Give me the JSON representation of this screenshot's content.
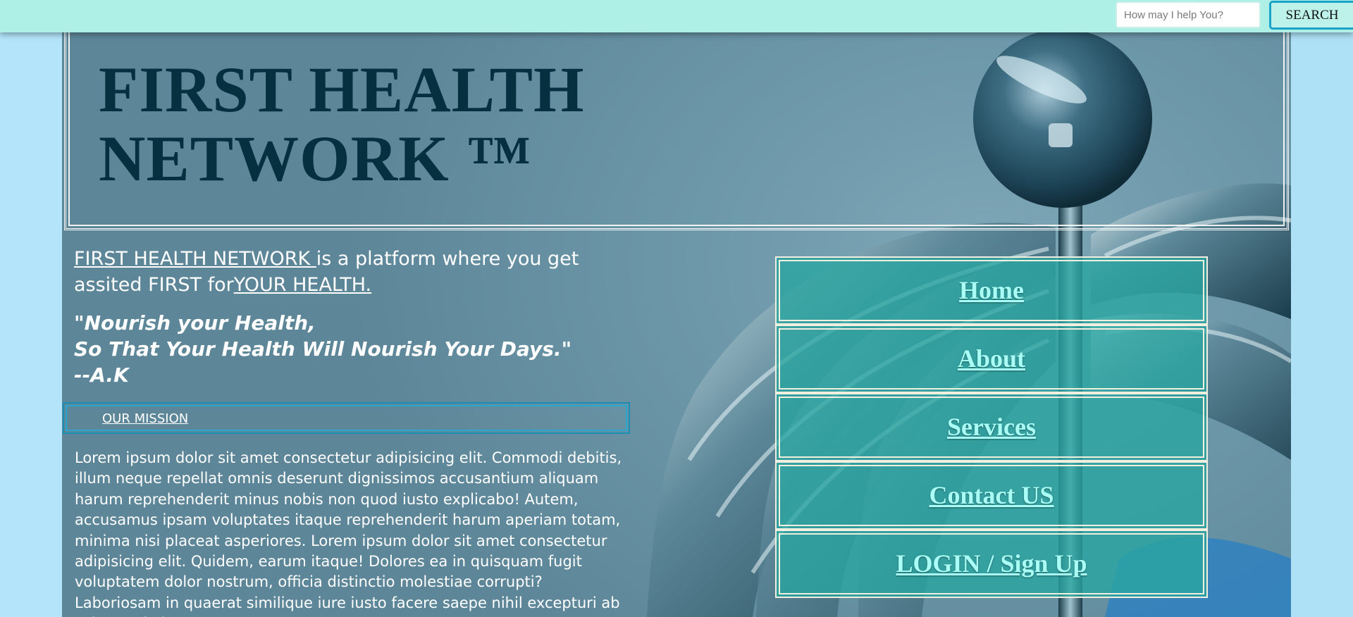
{
  "topbar": {
    "search_placeholder": "How may I help You?",
    "search_button_label": "SEARCH"
  },
  "header": {
    "title": "FIRST HEALTH\nNETWORK ™"
  },
  "intro": {
    "brand_link": "FIRST HEALTH NETWORK ",
    "text_part1": "is a platform where you get assited FIRST for",
    "health_link": "YOUR HEALTH."
  },
  "quote": {
    "line1": "\"Nourish your Health,",
    "line2": "So That Your Health Will Nourish Your Days.\"",
    "line3": "--A.K"
  },
  "mission": {
    "label": "OUR MISSION"
  },
  "body": {
    "lorem": "Lorem ipsum dolor sit amet consectetur adipisicing elit. Commodi debitis, illum neque repellat omnis deserunt dignissimos accusantium aliquam harum reprehenderit minus nobis non quod iusto explicabo! Autem, accusamus ipsam voluptates itaque reprehenderit harum aperiam totam, minima nisi placeat asperiores. Lorem ipsum dolor sit amet consectetur adipisicing elit. Quidem, earum itaque! Dolores ea in quisquam fugit voluptatem dolor nostrum, officia distinctio molestiae corrupti? Laboriosam in quaerat similique iure iusto facere saepe nihil excepturi ab soluta quia beatae"
  },
  "nav": {
    "items": [
      {
        "label": "Home"
      },
      {
        "label": "About"
      },
      {
        "label": "Services"
      },
      {
        "label": "Contact US"
      },
      {
        "label": "LOGIN / Sign Up"
      }
    ]
  },
  "colors": {
    "topbar_bg": "#aef0e6",
    "title_color": "#06303f",
    "nav_bg": "#28a5a0",
    "nav_text": "#a9fff6",
    "search_border": "#1aa3c7"
  },
  "icons": {
    "background_art": "caduceus-image"
  }
}
